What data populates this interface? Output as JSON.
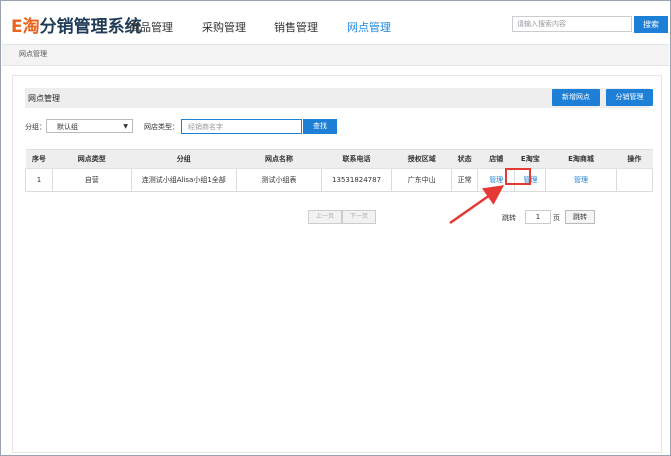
{
  "app": {
    "logo_e": "E淘",
    "logo_rest": "分销管理系统"
  },
  "nav": {
    "items": [
      "商品管理",
      "采购管理",
      "销售管理",
      "网点管理"
    ],
    "active_index": 3
  },
  "search": {
    "placeholder": "请输入搜索内容",
    "button": "搜索"
  },
  "breadcrumb": "网点管理",
  "panel": {
    "title": "网点管理",
    "add_button": "新增网点",
    "distribution_button": "分销管理"
  },
  "filters": {
    "group_label": "分组：",
    "group_value": "默认组",
    "type_label": "网店类型：",
    "type_placeholder": "经销商名字",
    "find_button": "查找"
  },
  "table": {
    "headers": [
      "序号",
      "网点类型",
      "分组",
      "网点名称",
      "联系电话",
      "授权区域",
      "状态",
      "店铺",
      "E淘宝",
      "E淘商城",
      "操作"
    ],
    "rows": [
      [
        "1",
        "自营",
        "连测试小组Alisa小组1全部",
        "测试小组表",
        "13531824787",
        "广东中山",
        "正常",
        "管理",
        "管理",
        "管理",
        ""
      ]
    ]
  },
  "pager": {
    "prev": "上一页",
    "next": "下一页",
    "jump_label": "跳转",
    "page_value": "1",
    "page_unit": "页",
    "jump_button": "跳转"
  },
  "colors": {
    "accent": "#1e7fd6",
    "logo_orange": "#e8641c",
    "highlight": "#e53935"
  }
}
